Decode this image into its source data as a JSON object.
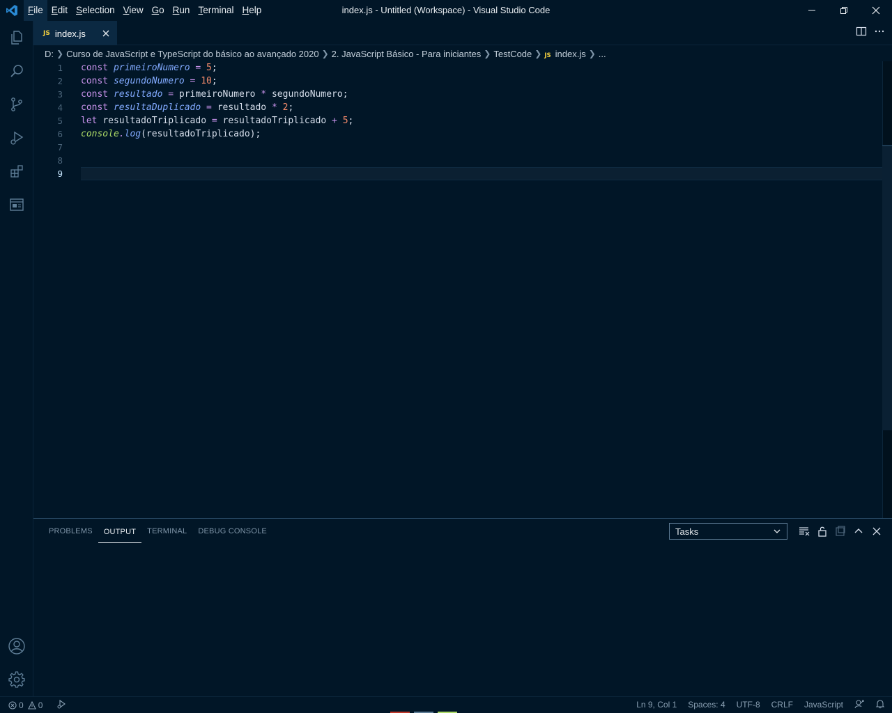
{
  "window": {
    "title": "index.js - Untitled (Workspace) - Visual Studio Code"
  },
  "menu": [
    {
      "mnemonic": "F",
      "rest": "ile"
    },
    {
      "mnemonic": "E",
      "rest": "dit"
    },
    {
      "mnemonic": "S",
      "rest": "election"
    },
    {
      "mnemonic": "V",
      "rest": "iew"
    },
    {
      "mnemonic": "G",
      "rest": "o"
    },
    {
      "mnemonic": "R",
      "rest": "un"
    },
    {
      "mnemonic": "T",
      "rest": "erminal"
    },
    {
      "mnemonic": "H",
      "rest": "elp"
    }
  ],
  "tab": {
    "badge": "JS",
    "label": "index.js"
  },
  "breadcrumb": {
    "drive": "D:",
    "folder1": "Curso de JavaScript e TypeScript do básico ao avançado 2020",
    "folder2": "2. JavaScript Básico - Para iniciantes",
    "folder3": "TestCode",
    "file_badge": "JS",
    "file": "index.js",
    "more": "..."
  },
  "editor": {
    "line_numbers": [
      "1",
      "2",
      "3",
      "4",
      "5",
      "6",
      "7",
      "8",
      "9"
    ],
    "active_line": "9",
    "lines": [
      {
        "kw": "const",
        "var": "primeiroNumero",
        "op": " = ",
        "num": "5",
        "end": ";"
      },
      {
        "kw": "const",
        "var": "segundoNumero",
        "op": " = ",
        "num": "10",
        "end": ";"
      },
      {
        "kw": "const",
        "var": "resultado",
        "op": " = ",
        "a": "primeiroNumero",
        "op2": " * ",
        "b": "segundoNumero",
        "end": ";"
      },
      {
        "kw": "const",
        "var": "resultaDuplicado",
        "op": " = ",
        "a": "resultado",
        "op2": " * ",
        "num": "2",
        "end": ";"
      },
      {
        "kw": "let",
        "a": "resultadoTriplicado",
        "op": " = ",
        "b": "resultadoTriplicado",
        "op2": " + ",
        "num": "5",
        "end": ";"
      },
      {
        "obj": "console",
        "dot": ".",
        "fn": "log",
        "args": "(resultadoTriplicado);"
      }
    ]
  },
  "panel": {
    "tabs": [
      "PROBLEMS",
      "OUTPUT",
      "TERMINAL",
      "DEBUG CONSOLE"
    ],
    "active_tab": "OUTPUT",
    "task_select": "Tasks"
  },
  "statusbar": {
    "errors": "0",
    "warnings": "0",
    "position": "Ln 9, Col 1",
    "spaces": "Spaces: 4",
    "encoding": "UTF-8",
    "eol": "CRLF",
    "language": "JavaScript"
  },
  "colors": {
    "background": "#011627",
    "keyword": "#c792ea",
    "variable": "#82aaff",
    "number": "#f78c6c",
    "object": "#addb67",
    "js_badge": "#f4d03f"
  }
}
